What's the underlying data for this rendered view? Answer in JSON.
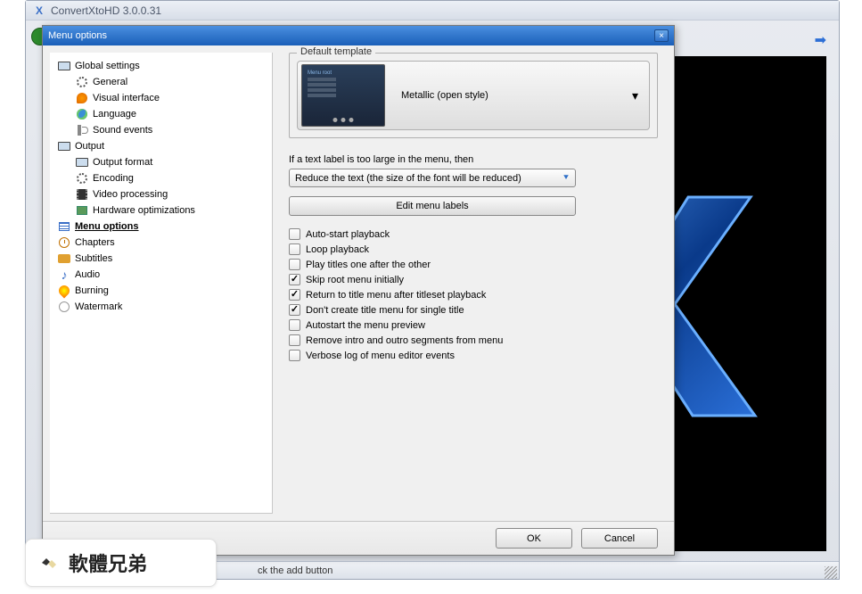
{
  "outer_window": {
    "title": "ConvertXtoHD 3.0.0.31",
    "status_text": "ck the add button"
  },
  "dialog": {
    "title": "Menu options",
    "close_label": "×",
    "ok_label": "OK",
    "cancel_label": "Cancel"
  },
  "tree": {
    "items": [
      {
        "level": 0,
        "icon": "monitor",
        "label": "Global settings"
      },
      {
        "level": 1,
        "icon": "gear",
        "label": "General"
      },
      {
        "level": 1,
        "icon": "palette",
        "label": "Visual interface"
      },
      {
        "level": 1,
        "icon": "globe",
        "label": "Language"
      },
      {
        "level": 1,
        "icon": "speaker",
        "label": "Sound events"
      },
      {
        "level": 0,
        "icon": "monitor",
        "label": "Output"
      },
      {
        "level": 1,
        "icon": "monitor",
        "label": "Output format"
      },
      {
        "level": 1,
        "icon": "gear",
        "label": "Encoding"
      },
      {
        "level": 1,
        "icon": "film",
        "label": "Video processing"
      },
      {
        "level": 1,
        "icon": "hw",
        "label": "Hardware optimizations"
      },
      {
        "level": 0,
        "icon": "menu",
        "label": "Menu options",
        "selected": true
      },
      {
        "level": 0,
        "icon": "clock",
        "label": "Chapters"
      },
      {
        "level": 0,
        "icon": "subtitle",
        "label": "Subtitles"
      },
      {
        "level": 0,
        "icon": "note",
        "label": "Audio"
      },
      {
        "level": 0,
        "icon": "burn",
        "label": "Burning"
      },
      {
        "level": 0,
        "icon": "water",
        "label": "Watermark"
      }
    ]
  },
  "content": {
    "default_template_legend": "Default template",
    "template_name": "Metallic (open style)",
    "text_large_label": "If a text label is too large in the menu, then",
    "text_large_option": "Reduce the text (the size of the font will be reduced)",
    "edit_menu_labels": "Edit menu labels",
    "checks": [
      {
        "label": "Auto-start playback",
        "checked": false
      },
      {
        "label": "Loop playback",
        "checked": false
      },
      {
        "label": "Play titles one after the other",
        "checked": false
      },
      {
        "label": "Skip root menu initially",
        "checked": true
      },
      {
        "label": "Return to title menu after titleset playback",
        "checked": true
      },
      {
        "label": "Don't create title menu for single title",
        "checked": true
      },
      {
        "label": "Autostart the menu preview",
        "checked": false
      },
      {
        "label": "Remove intro and outro segments from menu",
        "checked": false
      },
      {
        "label": "Verbose log of menu editor events",
        "checked": false
      }
    ]
  },
  "watermark_badge": {
    "text": "軟體兄弟"
  }
}
